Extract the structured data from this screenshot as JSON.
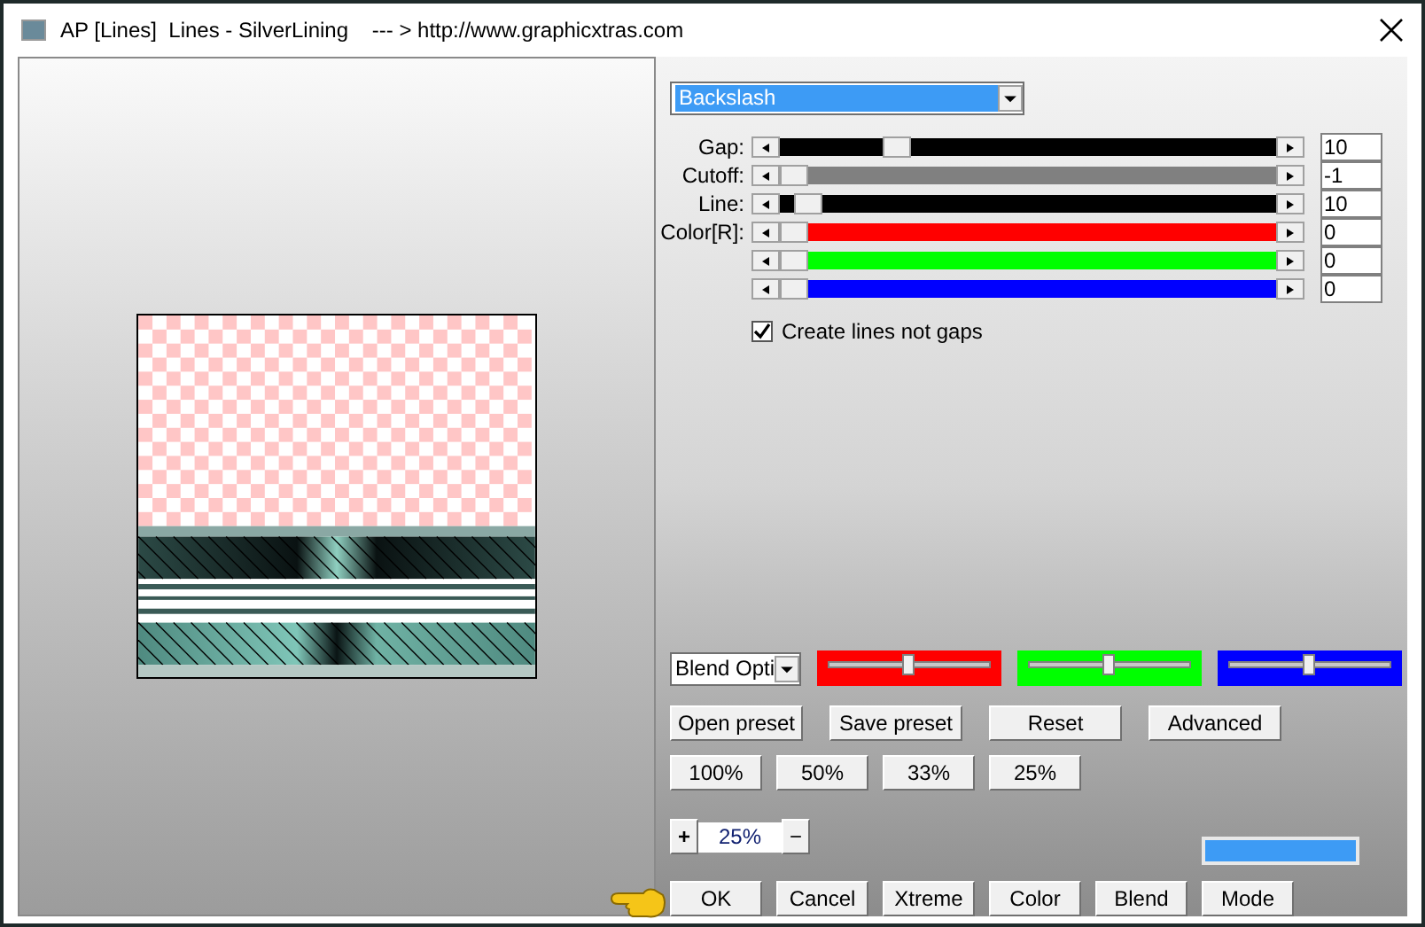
{
  "window": {
    "title": "AP [Lines]  Lines - SilverLining    --- > http://www.graphicxtras.com"
  },
  "mode_select": {
    "value": "Backslash"
  },
  "sliders": [
    {
      "label": "Gap:",
      "level": 0.22,
      "color": "#000000",
      "value": "10"
    },
    {
      "label": "Cutoff:",
      "level": 0.0,
      "color": "#808080",
      "value": "-1"
    },
    {
      "label": "Line:",
      "level": 0.03,
      "color": "#000000",
      "value": "10"
    },
    {
      "label": "Color[R]:",
      "level": 0.0,
      "color": "#ff0000",
      "value": "0"
    },
    {
      "level": 0.0,
      "color": "#00ff00",
      "value": "0"
    },
    {
      "level": 0.0,
      "color": "#0000ff",
      "value": "0"
    }
  ],
  "create_lines_checkbox": {
    "label": "Create lines not gaps",
    "checked": true
  },
  "blend_select": {
    "value": "Blend Opti"
  },
  "blend_sliders": [
    {
      "color": "#ff0000",
      "level": 0.5
    },
    {
      "color": "#00ff00",
      "level": 0.5
    },
    {
      "color": "#0000ff",
      "level": 0.5
    }
  ],
  "preset_buttons": [
    "Open preset",
    "Save preset",
    "Reset",
    "Advanced"
  ],
  "zoom_buttons": [
    "100%",
    "50%",
    "33%",
    "25%"
  ],
  "zoom_stepper": {
    "plus": "+",
    "value": "25%",
    "minus": "−"
  },
  "color_swatch": {
    "color": "#3d9bf5"
  },
  "bottom_buttons": [
    "OK",
    "Cancel",
    "Xtreme",
    "Color",
    "Blend",
    "Mode"
  ]
}
